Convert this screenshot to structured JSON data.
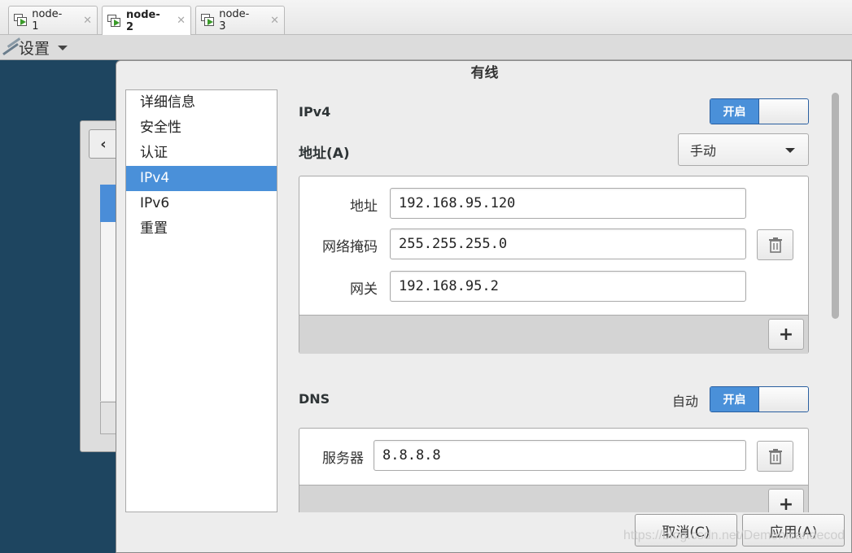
{
  "vm_tabs": [
    {
      "label": "node-1"
    },
    {
      "label": "node-2"
    },
    {
      "label": "node-3"
    }
  ],
  "menubar": {
    "settings_label": "设置"
  },
  "dialog": {
    "title": "有线",
    "sidebar": [
      "详细信息",
      "安全性",
      "认证",
      "IPv4",
      "IPv6",
      "重置"
    ],
    "active_item": "IPv4",
    "ipv4": {
      "section_title": "IPv4",
      "switch_label": "开启",
      "address_method_label": "地址(A)",
      "address_method_value": "手动"
    },
    "addresses": {
      "address_label": "地址",
      "address_value": "192.168.95.120",
      "netmask_label": "网络掩码",
      "netmask_value": "255.255.255.0",
      "gateway_label": "网关",
      "gateway_value": "192.168.95.2",
      "add_label": "+"
    },
    "dns": {
      "section_title": "DNS",
      "auto_label": "自动",
      "switch_label": "开启",
      "server_label": "服务器",
      "server_value": "8.8.8.8",
      "add_label": "+"
    },
    "buttons": {
      "cancel": "取消(C)",
      "apply": "应用(A)"
    }
  },
  "watermark": "https://blog.csdn.net/Demonicandecod",
  "colors": {
    "accent": "#4a90d9",
    "desktop": "#1e4560"
  }
}
